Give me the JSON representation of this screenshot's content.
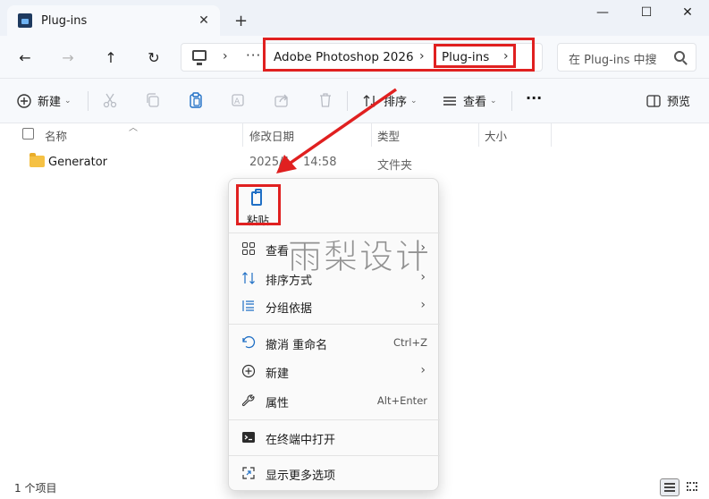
{
  "window": {
    "tab_title": "Plug-ins",
    "close_tab": "✕",
    "new_tab": "+",
    "minimize": "—",
    "maximize": "☐",
    "close": "✕"
  },
  "nav": {
    "back": "←",
    "forward": "→",
    "up": "↑",
    "refresh": "↻"
  },
  "breadcrumb": {
    "more": "···",
    "chevron": "›",
    "items": [
      "Adobe Photoshop 2026",
      "Plug-ins"
    ]
  },
  "search": {
    "placeholder": "在 Plug-ins 中搜"
  },
  "toolbar": {
    "new_label": "新建",
    "sort_label": "排序",
    "view_label": "查看",
    "more": "···",
    "preview_label": "预览",
    "dropdown": "⌄"
  },
  "columns": [
    "名称",
    "修改日期",
    "类型",
    "大小"
  ],
  "files": [
    {
      "name": "Generator",
      "modified": "2025/1 ",
      "modified_time": "14:58",
      "type": "文件夹",
      "size": ""
    }
  ],
  "status": {
    "count": "1 个项目"
  },
  "context_menu": {
    "paste_label": "粘贴",
    "items": [
      {
        "label": "查看",
        "shortcut": "",
        "submenu": true,
        "icon": "grid-view-icon"
      },
      {
        "label": "排序方式",
        "shortcut": "",
        "submenu": true,
        "icon": "sort-icon"
      },
      {
        "label": "分组依据",
        "shortcut": "",
        "submenu": true,
        "icon": "group-icon"
      },
      {
        "label": "撤消 重命名",
        "shortcut": "Ctrl+Z",
        "submenu": false,
        "icon": "undo-icon"
      },
      {
        "label": "新建",
        "shortcut": "",
        "submenu": true,
        "icon": "new-icon"
      },
      {
        "label": "属性",
        "shortcut": "Alt+Enter",
        "submenu": false,
        "icon": "wrench-icon"
      },
      {
        "label": "在终端中打开",
        "shortcut": "",
        "submenu": false,
        "icon": "terminal-icon"
      },
      {
        "label": "显示更多选项",
        "shortcut": "",
        "submenu": false,
        "icon": "more-options-icon"
      }
    ],
    "submenu_arrow": "›"
  },
  "watermark": "雨梨设计",
  "colors": {
    "highlight": "#e02020",
    "accent": "#1f6fc5",
    "folder": "#f5c144"
  }
}
